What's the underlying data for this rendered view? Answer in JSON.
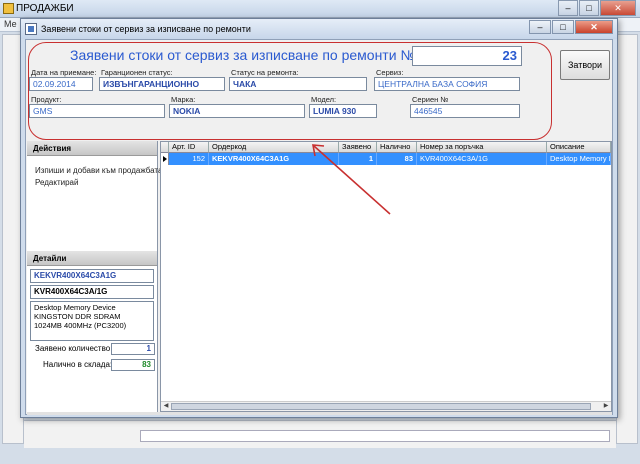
{
  "background_window": {
    "title": "ПРОДАЖБИ",
    "menu_text": "Ме"
  },
  "dialog": {
    "title": "Заявени стоки от сервиз за изписване по ремонти",
    "heading": "Заявени стоки от сервиз за изписване по ремонти №",
    "number": "23",
    "close_button": "Затвори",
    "fields": {
      "date_label": "Дата на приемане:",
      "date_value": "02.09.2014",
      "warranty_label": "Гаранционен статус:",
      "warranty_value": "ИЗВЪНГАРАНЦИОННО",
      "repair_status_label": "Статус на ремонта:",
      "repair_status_value": "ЧАКА",
      "service_label": "Сервиз:",
      "service_value": "ЦЕНТРАЛНА БАЗА СОФИЯ",
      "product_label": "Продукт:",
      "product_value": "GMS",
      "brand_label": "Марка:",
      "brand_value": "NOKIA",
      "model_label": "Модел:",
      "model_value": "LUMIA 930",
      "serial_label": "Сериен №",
      "serial_value": "446545"
    },
    "actions": {
      "header": "Действия",
      "items": [
        "Изпиши и добави към продажбата",
        "Редактирай"
      ]
    },
    "details": {
      "header": "Детайли",
      "code_bold": "KEKVR400X64C3A1G",
      "code": "KVR400X64C3A/1G",
      "description": "Desktop Memory Device KINGSTON DDR SDRAM 1024MB 400MHz (PC3200)",
      "requested_label": "Заявено количество:",
      "requested_value": "1",
      "stock_label": "Налично в склада:",
      "stock_value": "83"
    },
    "grid": {
      "columns": [
        "Арт. ID",
        "Ордеркод",
        "Заявено",
        "Налично",
        "Номер за поръчка",
        "Описание"
      ],
      "rows": [
        {
          "art_id": "152",
          "ordercode": "KEKVR400X64C3A1G",
          "requested": "1",
          "available": "83",
          "order_number": "KVR400X64C3A/1G",
          "description": "Desktop Memory De"
        }
      ]
    }
  },
  "annotation": {
    "color": "#c83030"
  }
}
